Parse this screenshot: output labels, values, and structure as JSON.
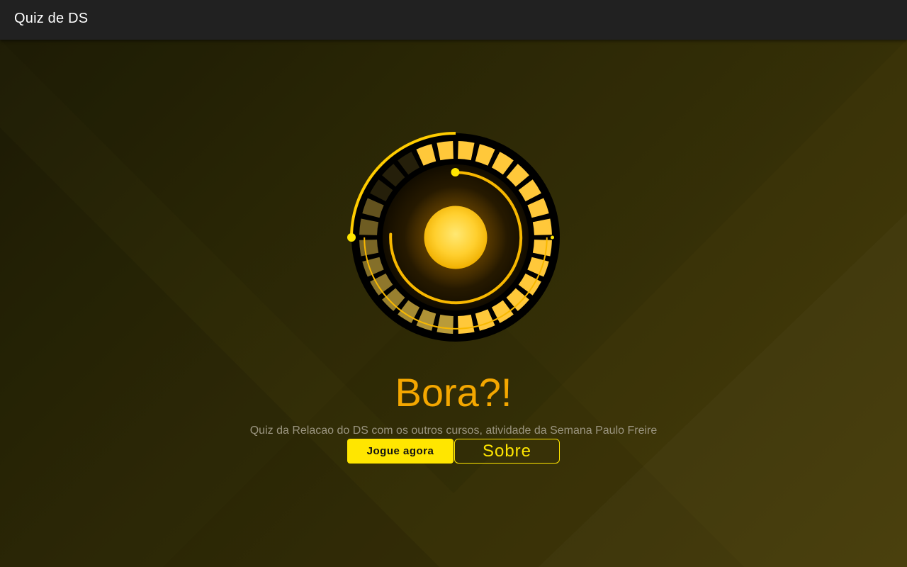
{
  "app": {
    "title": "Quiz de DS"
  },
  "hero": {
    "illustration_icon": "glowing-orb-dial-icon",
    "title": "Bora?!",
    "subtitle": "Quiz da Relacao do DS com os outros cursos, atividade da Semana Paulo Freire"
  },
  "actions": {
    "play_label": "Jogue agora",
    "about_label": "Sobre"
  },
  "colors": {
    "accent": "#ffe600",
    "title": "#f4a700",
    "topbar": "#212121",
    "background_dark": "#1e1c06",
    "background_light": "#463c08"
  }
}
